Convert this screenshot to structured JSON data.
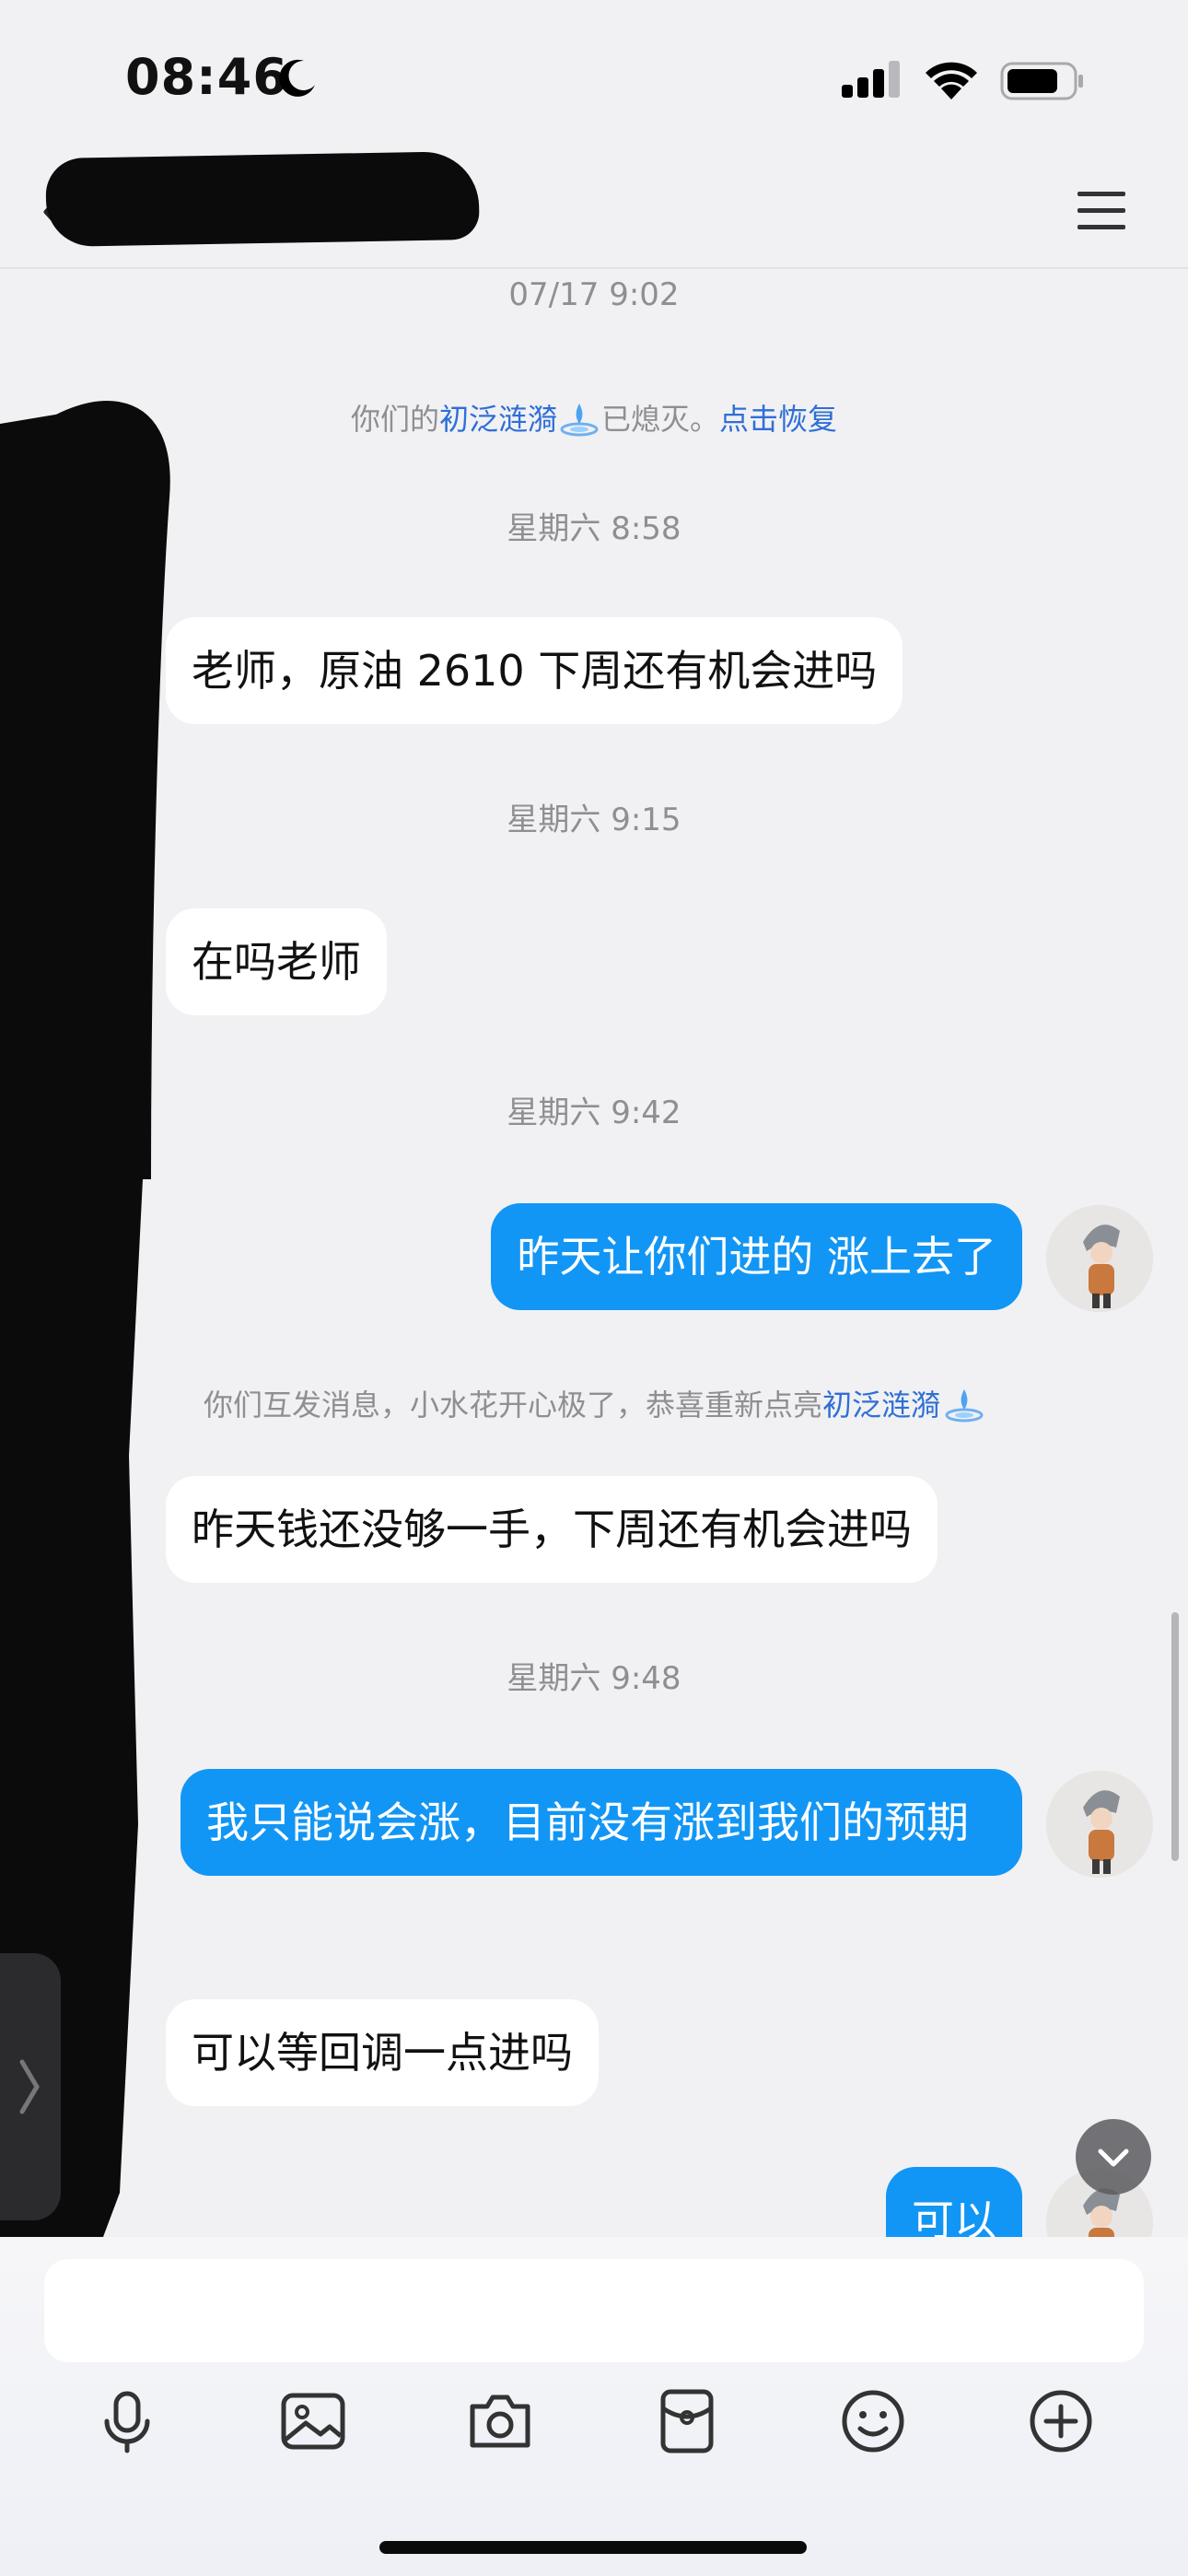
{
  "status_bar": {
    "time": "08:46"
  },
  "nav": {
    "title": ""
  },
  "messages": {
    "ts1": "07/17 9:02",
    "sys1_before": "你们的",
    "sys1_link": "初泛涟漪",
    "sys1_middle": "已熄灭。",
    "sys1_action": "点击恢复",
    "ts2": "星期六 8:58",
    "m1": "老师，原油 2610 下周还有机会进吗",
    "ts3": "星期六 9:15",
    "m2": "在吗老师",
    "ts4": "星期六 9:42",
    "m3": "昨天让你们进的   涨上去了",
    "sys2_before": "你们互发消息，小水花开心极了，恭喜重新点亮",
    "sys2_link": "初泛涟漪",
    "m4": "昨天钱还没够一手，下周还有机会进吗",
    "ts5": "星期六 9:48",
    "m5": "我只能说会涨，目前没有涨到我们的预期",
    "m6": "可以等回调一点进吗",
    "m7": "可以"
  },
  "icons": [
    "moon-icon",
    "signal-icon",
    "wifi-icon",
    "battery-icon",
    "back-icon",
    "menu-icon",
    "ripple-icon",
    "chevron-down-icon",
    "microphone-icon",
    "image-icon",
    "camera-icon",
    "red-packet-icon",
    "emoji-icon",
    "plus-icon"
  ],
  "colors": {
    "outgoing_bubble": "#1296f5",
    "incoming_bubble": "#ffffff",
    "link": "#2f6fd6",
    "background": "#f1f1f3"
  }
}
